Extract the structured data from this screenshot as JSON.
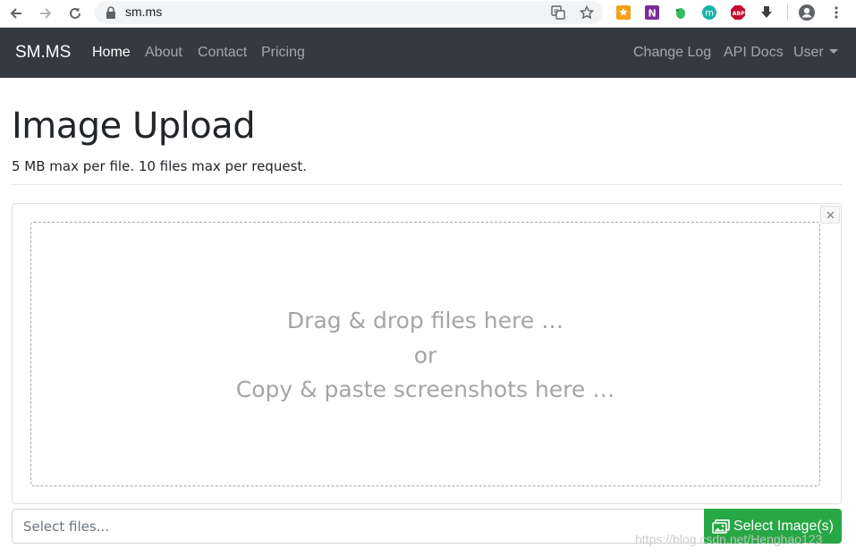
{
  "browser": {
    "url": "sm.ms",
    "extensions": [
      "star-extension-icon",
      "onenote-icon",
      "evernote-icon",
      "m-extension-icon",
      "adblock-plus-icon",
      "download-icon"
    ],
    "abp_label": "ABP",
    "m_label": "m",
    "onenote_label": "N"
  },
  "navbar": {
    "brand": "SM.MS",
    "left_links": [
      {
        "label": "Home",
        "active": true
      },
      {
        "label": "About",
        "active": false
      },
      {
        "label": "Contact",
        "active": false
      },
      {
        "label": "Pricing",
        "active": false
      }
    ],
    "right_links": [
      {
        "label": "Change Log"
      },
      {
        "label": "API Docs"
      },
      {
        "label": "User"
      }
    ]
  },
  "page": {
    "title": "Image Upload",
    "subtitle": "5 MB max per file. 10 files max per request."
  },
  "dropzone": {
    "line1": "Drag & drop files here …",
    "line2": "or",
    "line3": "Copy & paste screenshots here …",
    "close_label": "×"
  },
  "upload": {
    "placeholder": "Select files...",
    "button_label": "Select Image(s)"
  },
  "watermark": "https://blog.csdn.net/Henghao123",
  "colors": {
    "navbar_bg": "#343a40",
    "button_green": "#28a745",
    "drop_text": "#a5a5a5"
  }
}
